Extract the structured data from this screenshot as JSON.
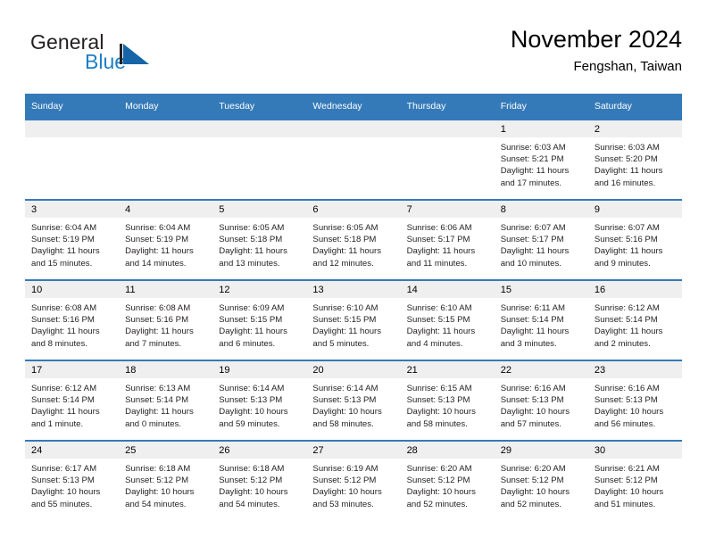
{
  "brand": {
    "name_dark": "General",
    "name_blue": "Blue",
    "mark_icon": "triangle-logo-icon",
    "dark_color": "#231f20",
    "blue_color": "#1d80c4"
  },
  "header": {
    "title": "November 2024",
    "subtitle": "Fengshan, Taiwan"
  },
  "theme": {
    "header_blue": "#357ab8",
    "daynum_band": "#efefef",
    "cell_bg": "#ffffff",
    "text": "#231f20"
  },
  "weekdays": [
    "Sunday",
    "Monday",
    "Tuesday",
    "Wednesday",
    "Thursday",
    "Friday",
    "Saturday"
  ],
  "labels": {
    "sunrise": "Sunrise:",
    "sunset": "Sunset:",
    "daylight": "Daylight:"
  },
  "weeks": [
    [
      {
        "day": "",
        "blank": true
      },
      {
        "day": "",
        "blank": true
      },
      {
        "day": "",
        "blank": true
      },
      {
        "day": "",
        "blank": true
      },
      {
        "day": "",
        "blank": true
      },
      {
        "day": "1",
        "sunrise": "Sunrise: 6:03 AM",
        "sunset": "Sunset: 5:21 PM",
        "daylight_1": "Daylight: 11 hours",
        "daylight_2": "and 17 minutes."
      },
      {
        "day": "2",
        "sunrise": "Sunrise: 6:03 AM",
        "sunset": "Sunset: 5:20 PM",
        "daylight_1": "Daylight: 11 hours",
        "daylight_2": "and 16 minutes."
      }
    ],
    [
      {
        "day": "3",
        "sunrise": "Sunrise: 6:04 AM",
        "sunset": "Sunset: 5:19 PM",
        "daylight_1": "Daylight: 11 hours",
        "daylight_2": "and 15 minutes."
      },
      {
        "day": "4",
        "sunrise": "Sunrise: 6:04 AM",
        "sunset": "Sunset: 5:19 PM",
        "daylight_1": "Daylight: 11 hours",
        "daylight_2": "and 14 minutes."
      },
      {
        "day": "5",
        "sunrise": "Sunrise: 6:05 AM",
        "sunset": "Sunset: 5:18 PM",
        "daylight_1": "Daylight: 11 hours",
        "daylight_2": "and 13 minutes."
      },
      {
        "day": "6",
        "sunrise": "Sunrise: 6:05 AM",
        "sunset": "Sunset: 5:18 PM",
        "daylight_1": "Daylight: 11 hours",
        "daylight_2": "and 12 minutes."
      },
      {
        "day": "7",
        "sunrise": "Sunrise: 6:06 AM",
        "sunset": "Sunset: 5:17 PM",
        "daylight_1": "Daylight: 11 hours",
        "daylight_2": "and 11 minutes."
      },
      {
        "day": "8",
        "sunrise": "Sunrise: 6:07 AM",
        "sunset": "Sunset: 5:17 PM",
        "daylight_1": "Daylight: 11 hours",
        "daylight_2": "and 10 minutes."
      },
      {
        "day": "9",
        "sunrise": "Sunrise: 6:07 AM",
        "sunset": "Sunset: 5:16 PM",
        "daylight_1": "Daylight: 11 hours",
        "daylight_2": "and 9 minutes."
      }
    ],
    [
      {
        "day": "10",
        "sunrise": "Sunrise: 6:08 AM",
        "sunset": "Sunset: 5:16 PM",
        "daylight_1": "Daylight: 11 hours",
        "daylight_2": "and 8 minutes."
      },
      {
        "day": "11",
        "sunrise": "Sunrise: 6:08 AM",
        "sunset": "Sunset: 5:16 PM",
        "daylight_1": "Daylight: 11 hours",
        "daylight_2": "and 7 minutes."
      },
      {
        "day": "12",
        "sunrise": "Sunrise: 6:09 AM",
        "sunset": "Sunset: 5:15 PM",
        "daylight_1": "Daylight: 11 hours",
        "daylight_2": "and 6 minutes."
      },
      {
        "day": "13",
        "sunrise": "Sunrise: 6:10 AM",
        "sunset": "Sunset: 5:15 PM",
        "daylight_1": "Daylight: 11 hours",
        "daylight_2": "and 5 minutes."
      },
      {
        "day": "14",
        "sunrise": "Sunrise: 6:10 AM",
        "sunset": "Sunset: 5:15 PM",
        "daylight_1": "Daylight: 11 hours",
        "daylight_2": "and 4 minutes."
      },
      {
        "day": "15",
        "sunrise": "Sunrise: 6:11 AM",
        "sunset": "Sunset: 5:14 PM",
        "daylight_1": "Daylight: 11 hours",
        "daylight_2": "and 3 minutes."
      },
      {
        "day": "16",
        "sunrise": "Sunrise: 6:12 AM",
        "sunset": "Sunset: 5:14 PM",
        "daylight_1": "Daylight: 11 hours",
        "daylight_2": "and 2 minutes."
      }
    ],
    [
      {
        "day": "17",
        "sunrise": "Sunrise: 6:12 AM",
        "sunset": "Sunset: 5:14 PM",
        "daylight_1": "Daylight: 11 hours",
        "daylight_2": "and 1 minute."
      },
      {
        "day": "18",
        "sunrise": "Sunrise: 6:13 AM",
        "sunset": "Sunset: 5:14 PM",
        "daylight_1": "Daylight: 11 hours",
        "daylight_2": "and 0 minutes."
      },
      {
        "day": "19",
        "sunrise": "Sunrise: 6:14 AM",
        "sunset": "Sunset: 5:13 PM",
        "daylight_1": "Daylight: 10 hours",
        "daylight_2": "and 59 minutes."
      },
      {
        "day": "20",
        "sunrise": "Sunrise: 6:14 AM",
        "sunset": "Sunset: 5:13 PM",
        "daylight_1": "Daylight: 10 hours",
        "daylight_2": "and 58 minutes."
      },
      {
        "day": "21",
        "sunrise": "Sunrise: 6:15 AM",
        "sunset": "Sunset: 5:13 PM",
        "daylight_1": "Daylight: 10 hours",
        "daylight_2": "and 58 minutes."
      },
      {
        "day": "22",
        "sunrise": "Sunrise: 6:16 AM",
        "sunset": "Sunset: 5:13 PM",
        "daylight_1": "Daylight: 10 hours",
        "daylight_2": "and 57 minutes."
      },
      {
        "day": "23",
        "sunrise": "Sunrise: 6:16 AM",
        "sunset": "Sunset: 5:13 PM",
        "daylight_1": "Daylight: 10 hours",
        "daylight_2": "and 56 minutes."
      }
    ],
    [
      {
        "day": "24",
        "sunrise": "Sunrise: 6:17 AM",
        "sunset": "Sunset: 5:13 PM",
        "daylight_1": "Daylight: 10 hours",
        "daylight_2": "and 55 minutes."
      },
      {
        "day": "25",
        "sunrise": "Sunrise: 6:18 AM",
        "sunset": "Sunset: 5:12 PM",
        "daylight_1": "Daylight: 10 hours",
        "daylight_2": "and 54 minutes."
      },
      {
        "day": "26",
        "sunrise": "Sunrise: 6:18 AM",
        "sunset": "Sunset: 5:12 PM",
        "daylight_1": "Daylight: 10 hours",
        "daylight_2": "and 54 minutes."
      },
      {
        "day": "27",
        "sunrise": "Sunrise: 6:19 AM",
        "sunset": "Sunset: 5:12 PM",
        "daylight_1": "Daylight: 10 hours",
        "daylight_2": "and 53 minutes."
      },
      {
        "day": "28",
        "sunrise": "Sunrise: 6:20 AM",
        "sunset": "Sunset: 5:12 PM",
        "daylight_1": "Daylight: 10 hours",
        "daylight_2": "and 52 minutes."
      },
      {
        "day": "29",
        "sunrise": "Sunrise: 6:20 AM",
        "sunset": "Sunset: 5:12 PM",
        "daylight_1": "Daylight: 10 hours",
        "daylight_2": "and 52 minutes."
      },
      {
        "day": "30",
        "sunrise": "Sunrise: 6:21 AM",
        "sunset": "Sunset: 5:12 PM",
        "daylight_1": "Daylight: 10 hours",
        "daylight_2": "and 51 minutes."
      }
    ]
  ]
}
